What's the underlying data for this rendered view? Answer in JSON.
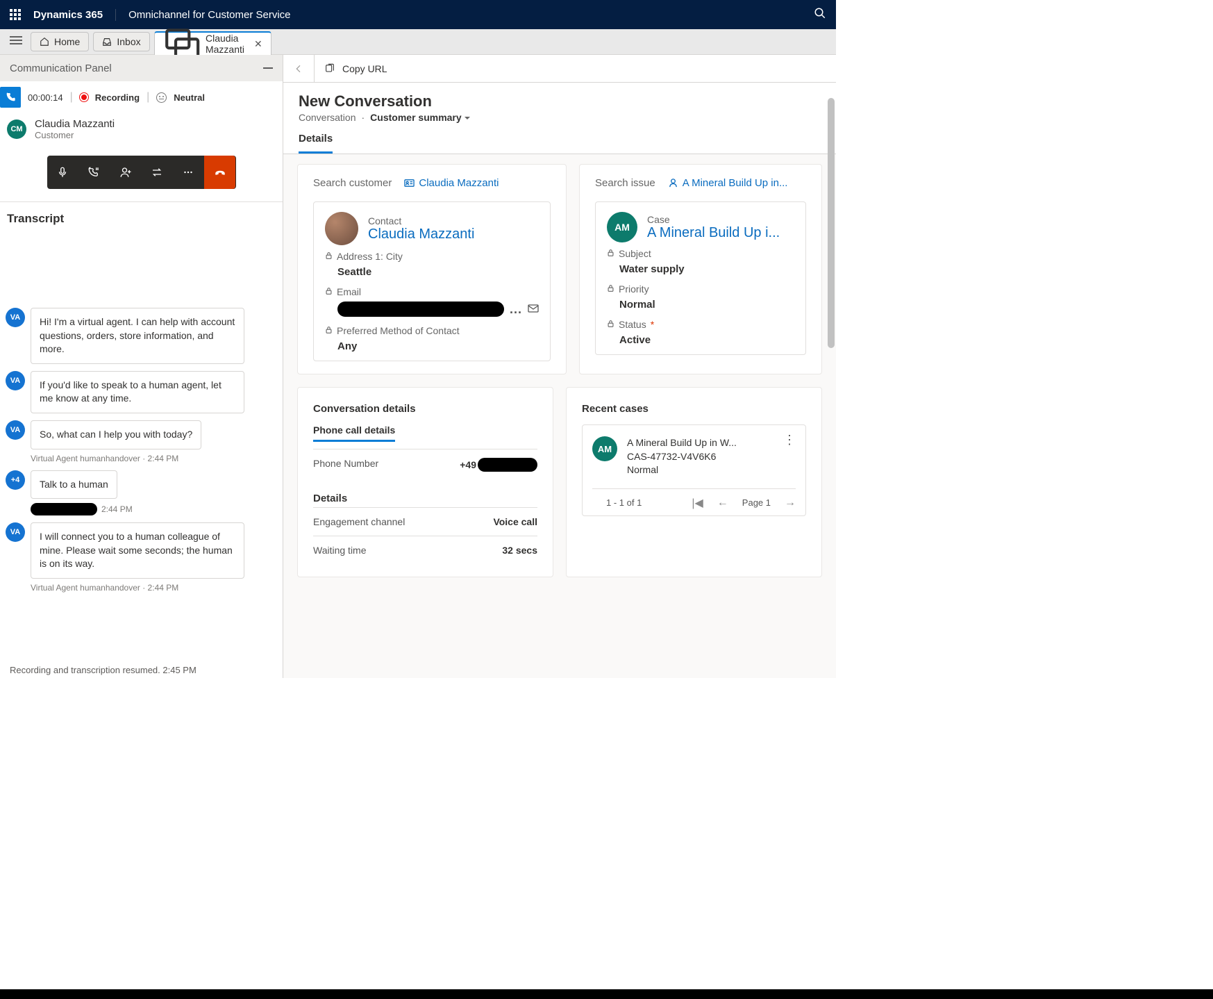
{
  "topbar": {
    "brand": "Dynamics 365",
    "appname": "Omnichannel for Customer Service"
  },
  "tabs": {
    "home": "Home",
    "inbox": "Inbox",
    "active": "Claudia Mazzanti"
  },
  "commpanel": {
    "title": "Communication Panel",
    "timer": "00:00:14",
    "recording": "Recording",
    "sentiment": "Neutral",
    "customer_name": "Claudia Mazzanti",
    "customer_role": "Customer",
    "avatar_initials": "CM",
    "transcript_label": "Transcript"
  },
  "messages": [
    {
      "avatar": "VA",
      "text": "Hi! I'm a virtual agent. I can help with account questions, orders, store information, and more."
    },
    {
      "avatar": "VA",
      "text": "If you'd like to speak to a human agent, let me know at any time."
    },
    {
      "avatar": "VA",
      "text": "So, what can I help you with today?",
      "meta": "Virtual Agent humanhandover · 2:44 PM"
    },
    {
      "avatar": "+4",
      "text": "Talk to a human",
      "meta_redacted": true,
      "meta_time": "2:44 PM"
    },
    {
      "avatar": "VA",
      "text": "I will connect you to a human colleague of mine. Please wait some seconds; the human is on its way.",
      "meta": "Virtual Agent humanhandover · 2:44 PM"
    }
  ],
  "sys_note": "Recording and transcription resumed. 2:45 PM",
  "right": {
    "copy_url": "Copy URL",
    "title": "New Conversation",
    "breadcrumb": "Conversation",
    "section_select": "Customer summary",
    "tab_details": "Details"
  },
  "customer_card": {
    "search_label": "Search customer",
    "link": "Claudia Mazzanti",
    "contact_label": "Contact",
    "contact_name": "Claudia Mazzanti",
    "fields": {
      "city_label": "Address 1: City",
      "city_value": "Seattle",
      "email_label": "Email",
      "pmoc_label": "Preferred Method of Contact",
      "pmoc_value": "Any"
    }
  },
  "issue_card": {
    "search_label": "Search issue",
    "link": "A Mineral Build Up in...",
    "case_label": "Case",
    "case_name": "A Mineral Build Up i...",
    "avatar": "AM",
    "fields": {
      "subject_label": "Subject",
      "subject_value": "Water supply",
      "priority_label": "Priority",
      "priority_value": "Normal",
      "status_label": "Status",
      "status_value": "Active"
    }
  },
  "conv_details": {
    "title": "Conversation details",
    "phone_tab": "Phone call details",
    "phone_number_label": "Phone Number",
    "phone_number_prefix": "+49",
    "details_sub": "Details",
    "engagement_label": "Engagement channel",
    "engagement_value": "Voice call",
    "waiting_label": "Waiting time",
    "waiting_value": "32 secs"
  },
  "recent": {
    "title": "Recent cases",
    "avatar": "AM",
    "line1": "A Mineral Build Up in W...",
    "line2": "CAS-47732-V4V6K6",
    "line3": "Normal",
    "pager_count": "1 - 1 of 1",
    "pager_page": "Page 1"
  }
}
